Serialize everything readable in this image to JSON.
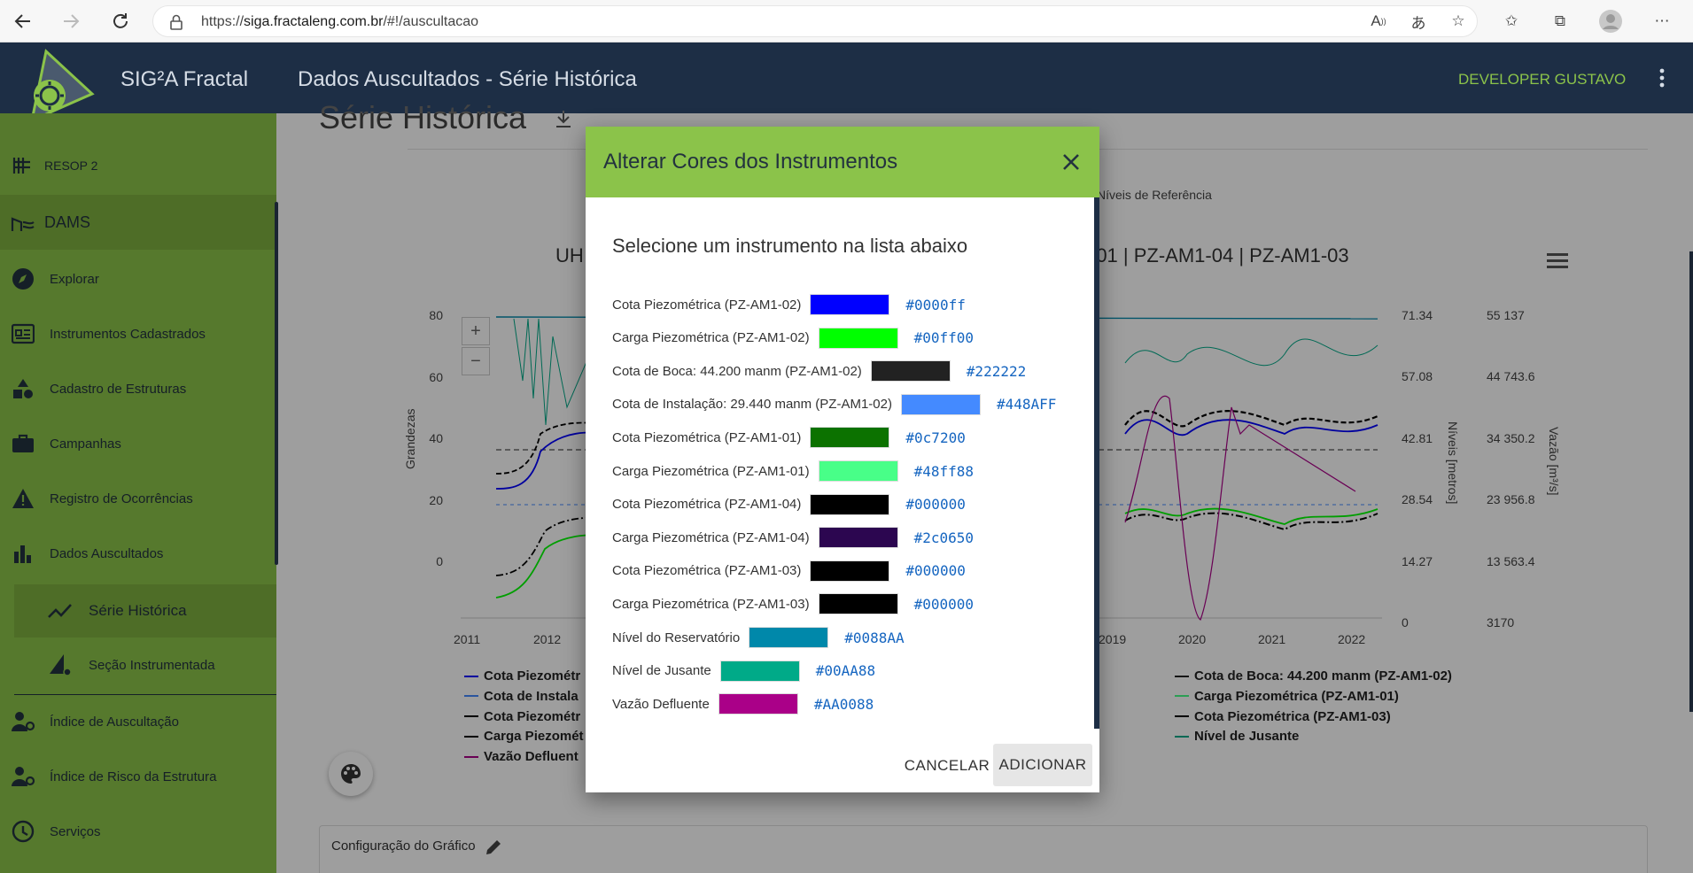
{
  "browser": {
    "url_prefix": "https://",
    "url_host": "siga.fractaleng.com.br",
    "url_path": "/#!/auscultacao"
  },
  "header": {
    "app_name": "SIG²A Fractal",
    "page_title": "Dados Auscultados - Série Histórica",
    "user": "DEVELOPER GUSTAVO"
  },
  "sidebar": {
    "items": [
      {
        "label": "RESOP 2",
        "icon": "building-icon"
      },
      {
        "label": "DAMS",
        "icon": "dam-icon"
      },
      {
        "label": "Explorar",
        "icon": "compass-icon"
      },
      {
        "label": "Instrumentos Cadastrados",
        "icon": "instrument-icon"
      },
      {
        "label": "Cadastro de Estruturas",
        "icon": "shapes-icon"
      },
      {
        "label": "Campanhas",
        "icon": "briefcase-icon"
      },
      {
        "label": "Registro de Ocorrências",
        "icon": "warning-icon"
      },
      {
        "label": "Dados Auscultados",
        "icon": "bar-chart-icon"
      },
      {
        "label": "Série Histórica",
        "icon": "trend-icon"
      },
      {
        "label": "Seção Instrumentada",
        "icon": "section-icon"
      },
      {
        "label": "Índice de Auscultação",
        "icon": "user-gear-icon"
      },
      {
        "label": "Índice de Risco da Estrutura",
        "icon": "user-gear-icon"
      },
      {
        "label": "Serviços",
        "icon": "clock-icon"
      }
    ]
  },
  "main": {
    "title": "Série Histórica",
    "niveis_ref": "Níveis de Referência",
    "chart_title_left": "UH",
    "chart_title_right": "-01 | PZ-AM1-04 | PZ-AM1-03",
    "config_label": "Configuração do Gráfico"
  },
  "chart_data": {
    "type": "line",
    "x_ticks": [
      "2011",
      "2012",
      "2019",
      "2020",
      "2021",
      "2022"
    ],
    "y_left_ticks": [
      "80",
      "60",
      "40",
      "20",
      "0"
    ],
    "y_mid_ticks": [
      "71.34",
      "57.08",
      "42.81",
      "28.54",
      "14.27",
      "0"
    ],
    "y_right_ticks": [
      "55 137",
      "44 743.6",
      "34 350.2",
      "23 956.8",
      "13 563.4",
      "3170"
    ],
    "ylabel_left": "Grandezas",
    "ylabel_mid": "Níveis [metros]",
    "ylabel_right": "Vazão [m³/s]",
    "ylim": [
      0,
      80
    ],
    "grid": false,
    "legend_position": "bottom",
    "legend_left": [
      {
        "name": "Cota Piezométr",
        "color": "#0000ff"
      },
      {
        "name": "Cota de Instala",
        "color": "#448AFF"
      },
      {
        "name": "Cota Piezométr",
        "color": "#000000"
      },
      {
        "name": "Carga Piezomét",
        "color": "#000000"
      },
      {
        "name": "Vazão Defluent",
        "color": "#AA0088"
      }
    ],
    "legend_right": [
      {
        "name": "Cota de Boca: 44.200 manm (PZ-AM1-02)",
        "color": "#222222"
      },
      {
        "name": "Carga Piezométrica (PZ-AM1-01)",
        "color": "#48ff88"
      },
      {
        "name": "Cota Piezométrica (PZ-AM1-03)",
        "color": "#000000"
      },
      {
        "name": "Nível de Jusante",
        "color": "#00AA88"
      }
    ]
  },
  "dialog": {
    "title": "Alterar Cores dos Instrumentos",
    "subtitle": "Selecione um instrumento na lista abaixo",
    "rows": [
      {
        "label": "Cota Piezométrica (PZ-AM1-02)",
        "color": "#0000ff",
        "hex": "#0000ff"
      },
      {
        "label": "Carga Piezométrica (PZ-AM1-02)",
        "color": "#00ff00",
        "hex": "#00ff00"
      },
      {
        "label": "Cota de Boca: 44.200 manm (PZ-AM1-02)",
        "color": "#222222",
        "hex": "#222222"
      },
      {
        "label": "Cota de Instalação: 29.440 manm (PZ-AM1-02)",
        "color": "#448AFF",
        "hex": "#448AFF"
      },
      {
        "label": "Cota Piezométrica (PZ-AM1-01)",
        "color": "#0c7200",
        "hex": "#0c7200"
      },
      {
        "label": "Carga Piezométrica (PZ-AM1-01)",
        "color": "#48ff88",
        "hex": "#48ff88"
      },
      {
        "label": "Cota Piezométrica (PZ-AM1-04)",
        "color": "#000000",
        "hex": "#000000"
      },
      {
        "label": "Carga Piezométrica (PZ-AM1-04)",
        "color": "#2c0650",
        "hex": "#2c0650"
      },
      {
        "label": "Cota Piezométrica (PZ-AM1-03)",
        "color": "#000000",
        "hex": "#000000"
      },
      {
        "label": "Carga Piezométrica (PZ-AM1-03)",
        "color": "#000000",
        "hex": "#000000"
      },
      {
        "label": "Nível do Reservatório",
        "color": "#0088AA",
        "hex": "#0088AA"
      },
      {
        "label": "Nível de Jusante",
        "color": "#00AA88",
        "hex": "#00AA88"
      },
      {
        "label": "Vazão Defluente",
        "color": "#AA0088",
        "hex": "#AA0088"
      }
    ],
    "cancel_label": "CANCELAR",
    "add_label": "ADICIONAR"
  },
  "colors": {
    "header_bg": "#1d2e45",
    "accent_green": "#8bc34a",
    "link_blue": "#1565c0"
  }
}
